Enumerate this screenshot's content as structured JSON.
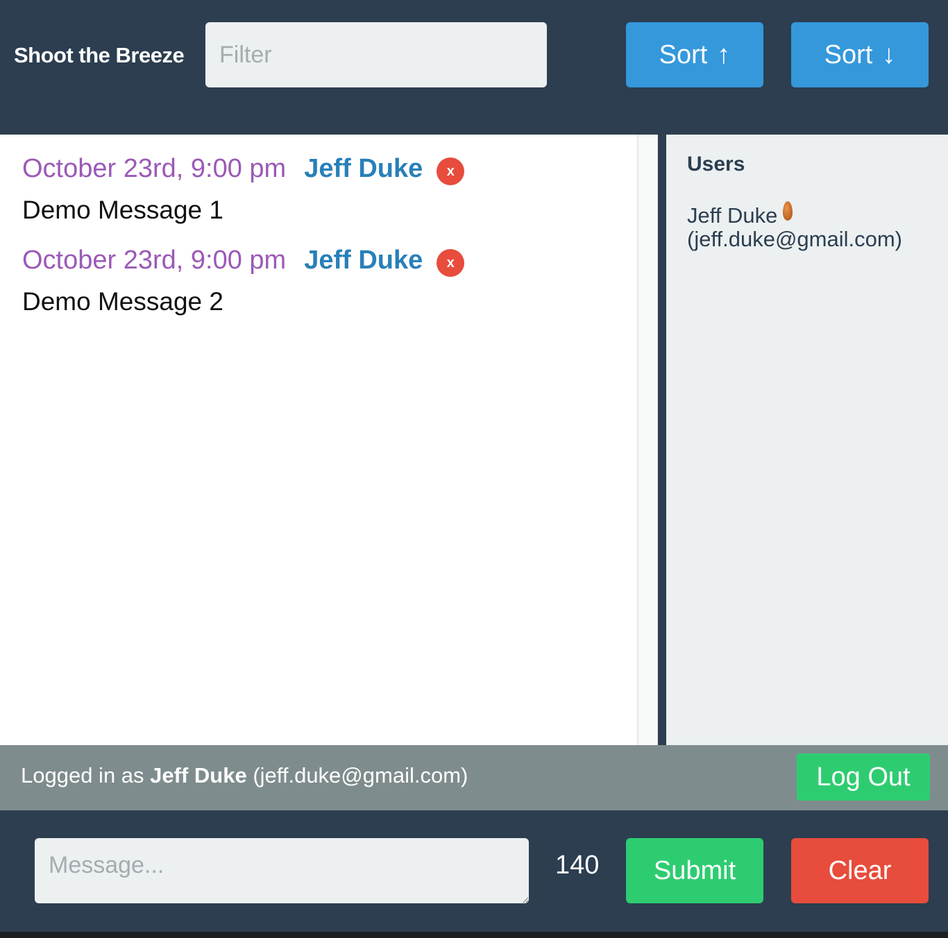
{
  "header": {
    "title": "Shoot the Breeze",
    "filter_placeholder": "Filter",
    "sort_asc_label": "Sort",
    "sort_asc_icon": "↑",
    "sort_desc_label": "Sort",
    "sort_desc_icon": "↓"
  },
  "messages": [
    {
      "time": "October 23rd, 9:00 pm",
      "author": "Jeff Duke",
      "delete_label": "x",
      "text": "Demo Message 1"
    },
    {
      "time": "October 23rd, 9:00 pm",
      "author": "Jeff Duke",
      "delete_label": "x",
      "text": "Demo Message 2"
    }
  ],
  "users": {
    "title": "Users",
    "list": [
      {
        "name": "Jeff Duke",
        "email": "(jeff.duke@gmail.com)",
        "status_icon": "almond-icon"
      }
    ]
  },
  "status": {
    "prefix": "Logged in as",
    "user_name": "Jeff Duke",
    "user_email": "(jeff.duke@gmail.com)",
    "logout_label": "Log Out"
  },
  "composer": {
    "placeholder": "Message...",
    "char_count": "140",
    "submit_label": "Submit",
    "clear_label": "Clear"
  },
  "colors": {
    "navy": "#2c3e50",
    "blue": "#3498db",
    "green": "#2ecc71",
    "red": "#e74c3c",
    "purple": "#9b59b6",
    "author_blue": "#2980b9",
    "gray": "#7f8c8d",
    "light": "#ecf0f1"
  }
}
